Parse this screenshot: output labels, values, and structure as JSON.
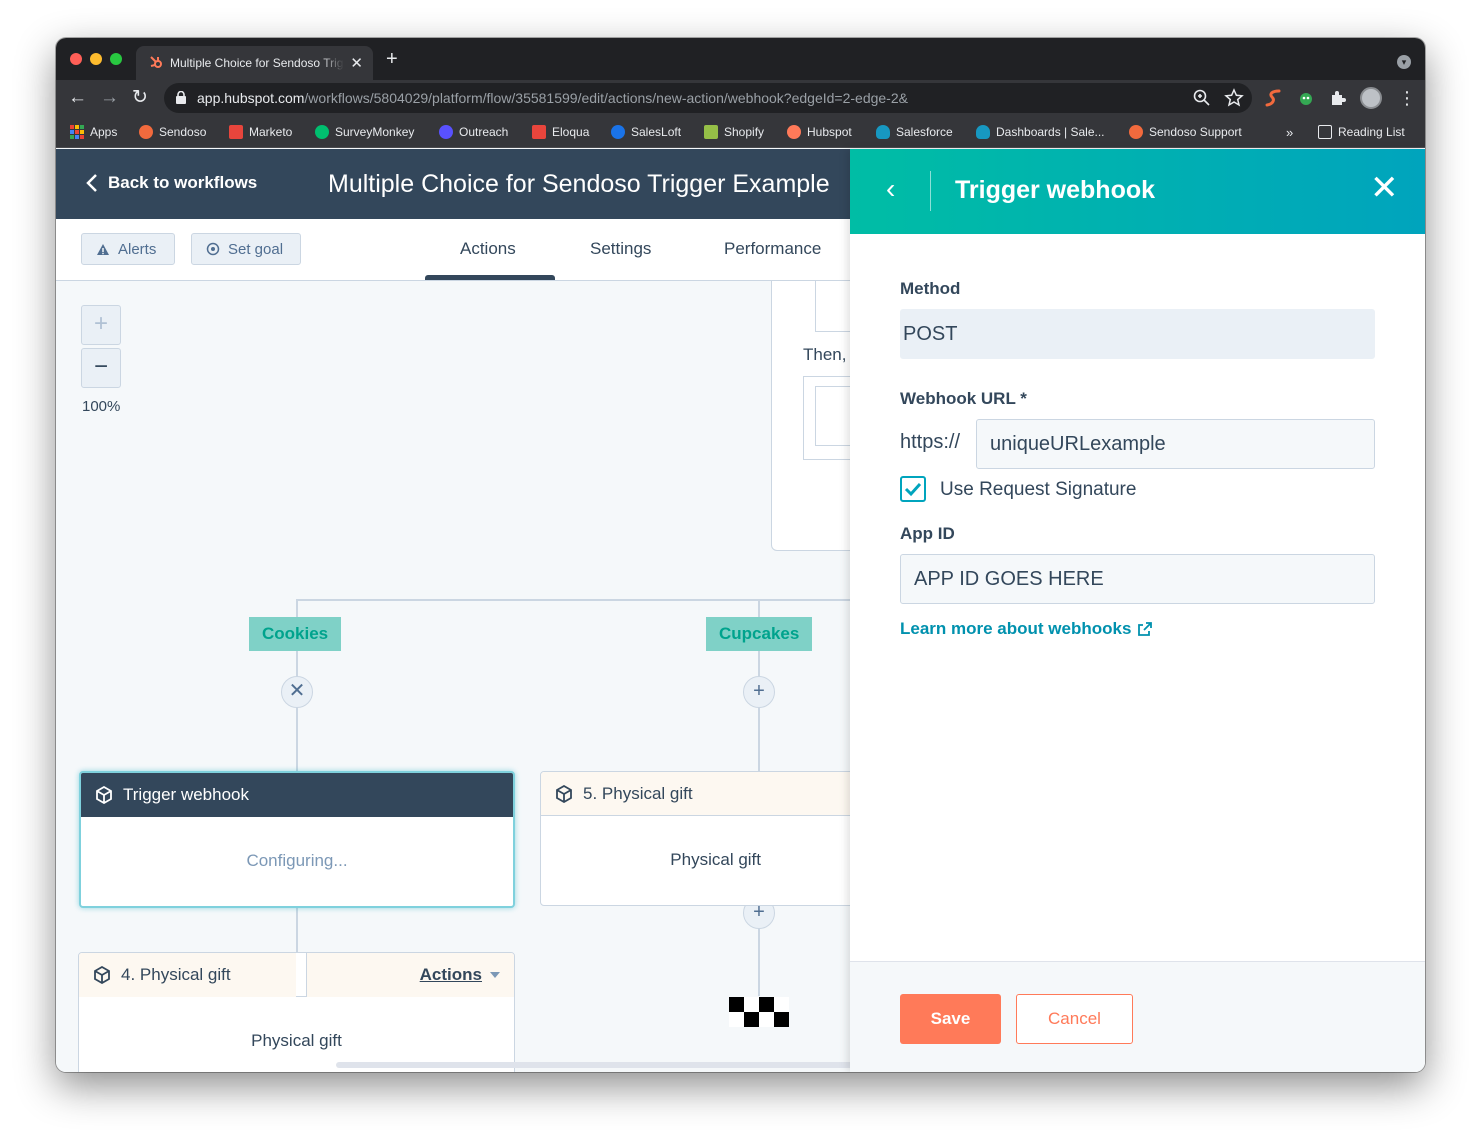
{
  "browser": {
    "tab_title": "Multiple Choice for Sendoso Trigger Example",
    "url_domain": "app.hubspot.com",
    "url_path": "/workflows/5804029/platform/flow/35581599/edit/actions/new-action/webhook?edgeId=2-edge-2&",
    "bookmarks": [
      {
        "label": "Apps",
        "color": "#4285f4"
      },
      {
        "label": "Sendoso",
        "color": "#f26a3d"
      },
      {
        "label": "Marketo",
        "color": "#e8453c"
      },
      {
        "label": "SurveyMonkey",
        "color": "#00bf6f"
      },
      {
        "label": "Outreach",
        "color": "#5951ff"
      },
      {
        "label": "Eloqua",
        "color": "#e8453c"
      },
      {
        "label": "SalesLoft",
        "color": "#1a73e8"
      },
      {
        "label": "Shopify",
        "color": "#95bf47"
      },
      {
        "label": "Hubspot",
        "color": "#ff7a59"
      },
      {
        "label": "Salesforce",
        "color": "#1798c1"
      },
      {
        "label": "Dashboards | Sale...",
        "color": "#1798c1"
      },
      {
        "label": "Sendoso Support",
        "color": "#f26a3d"
      }
    ],
    "overflow": "»",
    "reading_list": "Reading List"
  },
  "app": {
    "back_label": "Back to workflows",
    "workflow_name": "Multiple Choice for Sendoso Trigger Example",
    "alerts_label": "Alerts",
    "set_goal_label": "Set goal",
    "tabs": [
      "Actions",
      "Settings",
      "Performance"
    ],
    "zoom_level": "100%"
  },
  "canvas": {
    "partial_text": "Then,",
    "branches": [
      "Cookies",
      "Cupcakes"
    ],
    "cards": {
      "webhook": {
        "title": "Trigger webhook",
        "body": "Configuring..."
      },
      "gift5": {
        "title": "5. Physical gift",
        "body": "Physical gift"
      },
      "gift4": {
        "title": "4. Physical gift",
        "body": "Physical gift",
        "actions": "Actions"
      }
    }
  },
  "panel": {
    "title": "Trigger webhook",
    "method_label": "Method",
    "method_value": "POST",
    "url_label": "Webhook URL *",
    "url_prefix": "https://",
    "url_value": "uniqueURLexample",
    "signature_label": "Use Request Signature",
    "signature_checked": true,
    "app_id_label": "App ID",
    "app_id_value": "APP ID GOES HERE",
    "learn_more": "Learn more about webhooks",
    "save_label": "Save",
    "cancel_label": "Cancel"
  },
  "colors": {
    "nav_dark": "#33475b",
    "panel_gradient_start": "#00bda5",
    "panel_gradient_end": "#00a4bd",
    "primary_orange": "#ff7a59",
    "branch_teal": "#7fd1c7",
    "link_blue": "#0091ae"
  }
}
